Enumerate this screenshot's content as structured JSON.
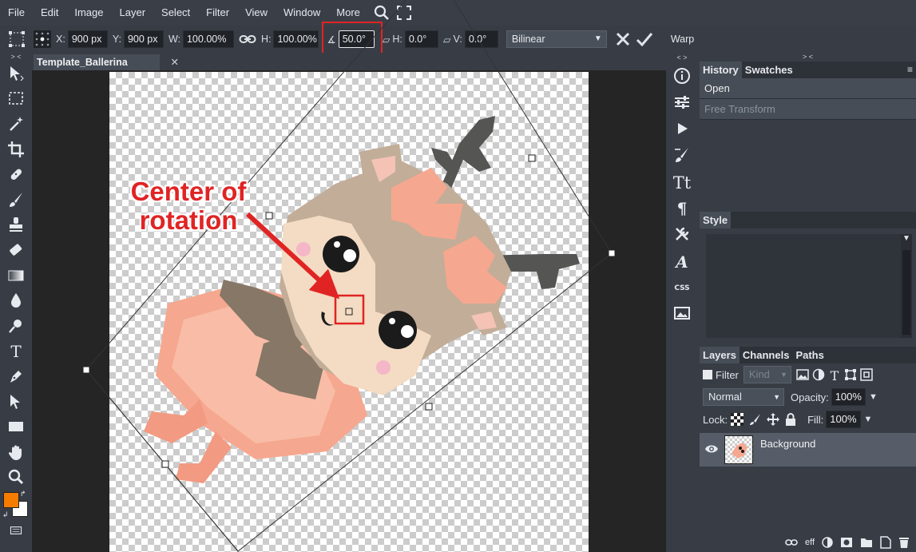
{
  "menu": [
    "File",
    "Edit",
    "Image",
    "Layer",
    "Select",
    "Filter",
    "View",
    "Window",
    "More"
  ],
  "options": {
    "x_label": "X:",
    "x_value": "900 px",
    "y_label": "Y:",
    "y_value": "900 px",
    "w_label": "W:",
    "w_value": "100.00%",
    "h_label": "H:",
    "h_value": "100.00%",
    "rotate_label": "∡",
    "rotate_value": "50.0°",
    "skew_h_label": "H:",
    "skew_h_value": "0.0°",
    "skew_v_label": "V:",
    "skew_v_value": "0.0°",
    "interpolation": "Bilinear",
    "warp_label": "Warp"
  },
  "document": {
    "tab_title": "Template_Ballerina",
    "close": "✕"
  },
  "annotation": {
    "line1": "Center of",
    "line2": "rotation",
    "color": "#e02424"
  },
  "collapse_left": "> <",
  "collapse_strip": "< >",
  "collapse_right": "> <",
  "history": {
    "tabs": [
      "History",
      "Swatches"
    ],
    "items": [
      "Open",
      "Free Transform"
    ]
  },
  "style": {
    "title": "Style"
  },
  "layers": {
    "tabs": [
      "Layers",
      "Channels",
      "Paths"
    ],
    "filter_label": "Filter",
    "kind_label": "Kind",
    "blend_mode": "Normal",
    "opacity_label": "Opacity:",
    "opacity_value": "100%",
    "lock_label": "Lock:",
    "fill_label": "Fill:",
    "fill_value": "100%",
    "items": [
      {
        "name": "Background"
      }
    ],
    "footer_eff": "eff"
  },
  "colors": {
    "foreground": "#f57c00",
    "background": "#ffffff",
    "accent": "#e02424"
  }
}
